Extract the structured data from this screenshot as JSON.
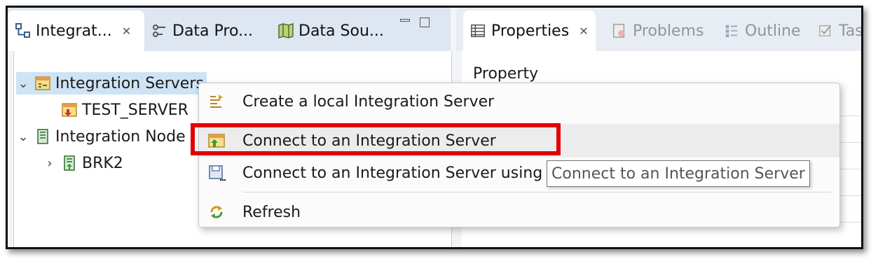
{
  "left_tabs": [
    {
      "label": "Integrat...",
      "icon": "integration-explorer-icon",
      "active": true
    },
    {
      "label": "Data Pro...",
      "icon": "data-project-icon"
    },
    {
      "label": "Data Sou...",
      "icon": "data-source-map-icon"
    }
  ],
  "tree": {
    "root1": {
      "label": "Integration Servers",
      "icon": "integration-servers-icon",
      "expanded": true
    },
    "child1": {
      "label": "TEST_SERVER",
      "icon": "server-stopped-icon"
    },
    "root2": {
      "label": "Integration Node",
      "icon": "integration-nodes-icon",
      "expanded": true
    },
    "child2": {
      "label": "BRK2",
      "icon": "broker-icon"
    }
  },
  "right_tabs": [
    {
      "label": "Properties",
      "icon": "properties-icon",
      "active": true
    },
    {
      "label": "Problems",
      "icon": "problems-icon"
    },
    {
      "label": "Outline",
      "icon": "outline-icon"
    },
    {
      "label": "Tas",
      "icon": "tasks-icon"
    }
  ],
  "properties": {
    "header": "Property"
  },
  "context_menu": {
    "items": [
      {
        "label": "Create a local Integration Server",
        "icon": "create-server-icon"
      },
      {
        "label": "Connect to an Integration Server",
        "icon": "connect-server-icon"
      },
      {
        "label": "Connect to an Integration Server using",
        "icon": "connect-file-icon"
      },
      {
        "label": "Refresh",
        "icon": "refresh-icon"
      }
    ]
  },
  "tooltip": {
    "text": "Connect to an Integration Server"
  },
  "colors": {
    "highlight": "#e00000",
    "selection": "#cfe3f7",
    "tabbar": "#dde6f1"
  }
}
